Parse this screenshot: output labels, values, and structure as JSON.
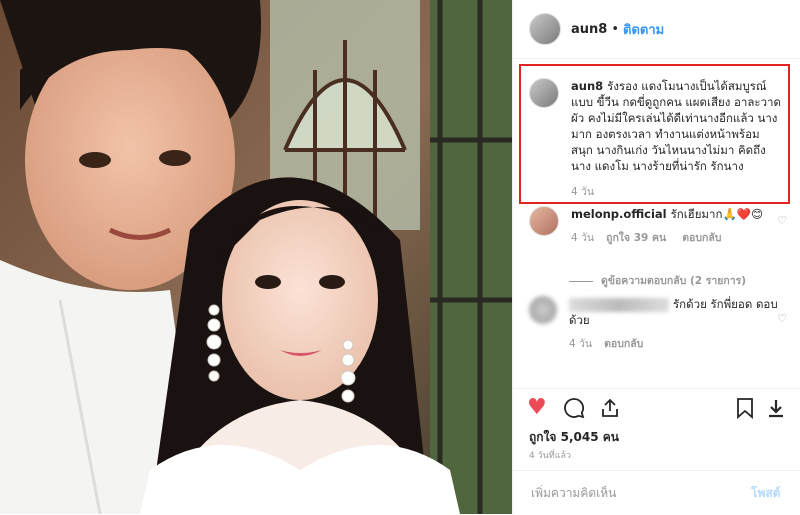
{
  "post": {
    "username": "aun8",
    "dot": "•",
    "follow_label": "ติดตาม",
    "likes_text": "ถูกใจ 5,045 คน",
    "timestamp": "4 วันที่แล้ว"
  },
  "comments": [
    {
      "username": "aun8",
      "text": "รังรอง แดงโมนางเป็นได้สมบูรณ์แบบ ขี้วีน กดขี่ดูถูกคน แผดเสียง อาละวาดผัว คงไม่มีใครเล่นได้ดีเท่านางอีกแล้ว นางมาก องตรงเวลา ทำงานแต่งหน้าพร้อม สนุก นางกินเก่ง วันไหนนางไม่มา คิดถึงนาง แดงโม นางร้ายที่น่ารัก รักนาง",
      "time": "4 วัน"
    },
    {
      "username": "melonp.official",
      "text": "รักเฮียมาก🙏❤️😊",
      "time": "4 วัน",
      "likes": "ถูกใจ 39 คน",
      "reply": "ตอบกลับ",
      "view_replies": "ดูข้อความตอบกลับ (2 รายการ)"
    },
    {
      "username": "",
      "text": "รักด้วย รักพี่ยอด ดอบด้วย",
      "time": "4 วัน",
      "reply": "ตอบกลับ"
    }
  ],
  "add_comment": {
    "placeholder": "เพิ่มความคิดเห็น",
    "post_label": "โพสต์"
  },
  "colors": {
    "accent": "#3897f0",
    "highlight": "#e02424",
    "heart": "#ed4956"
  },
  "icons": [
    "heart-icon",
    "comment-icon",
    "share-icon",
    "bookmark-icon",
    "download-icon"
  ]
}
